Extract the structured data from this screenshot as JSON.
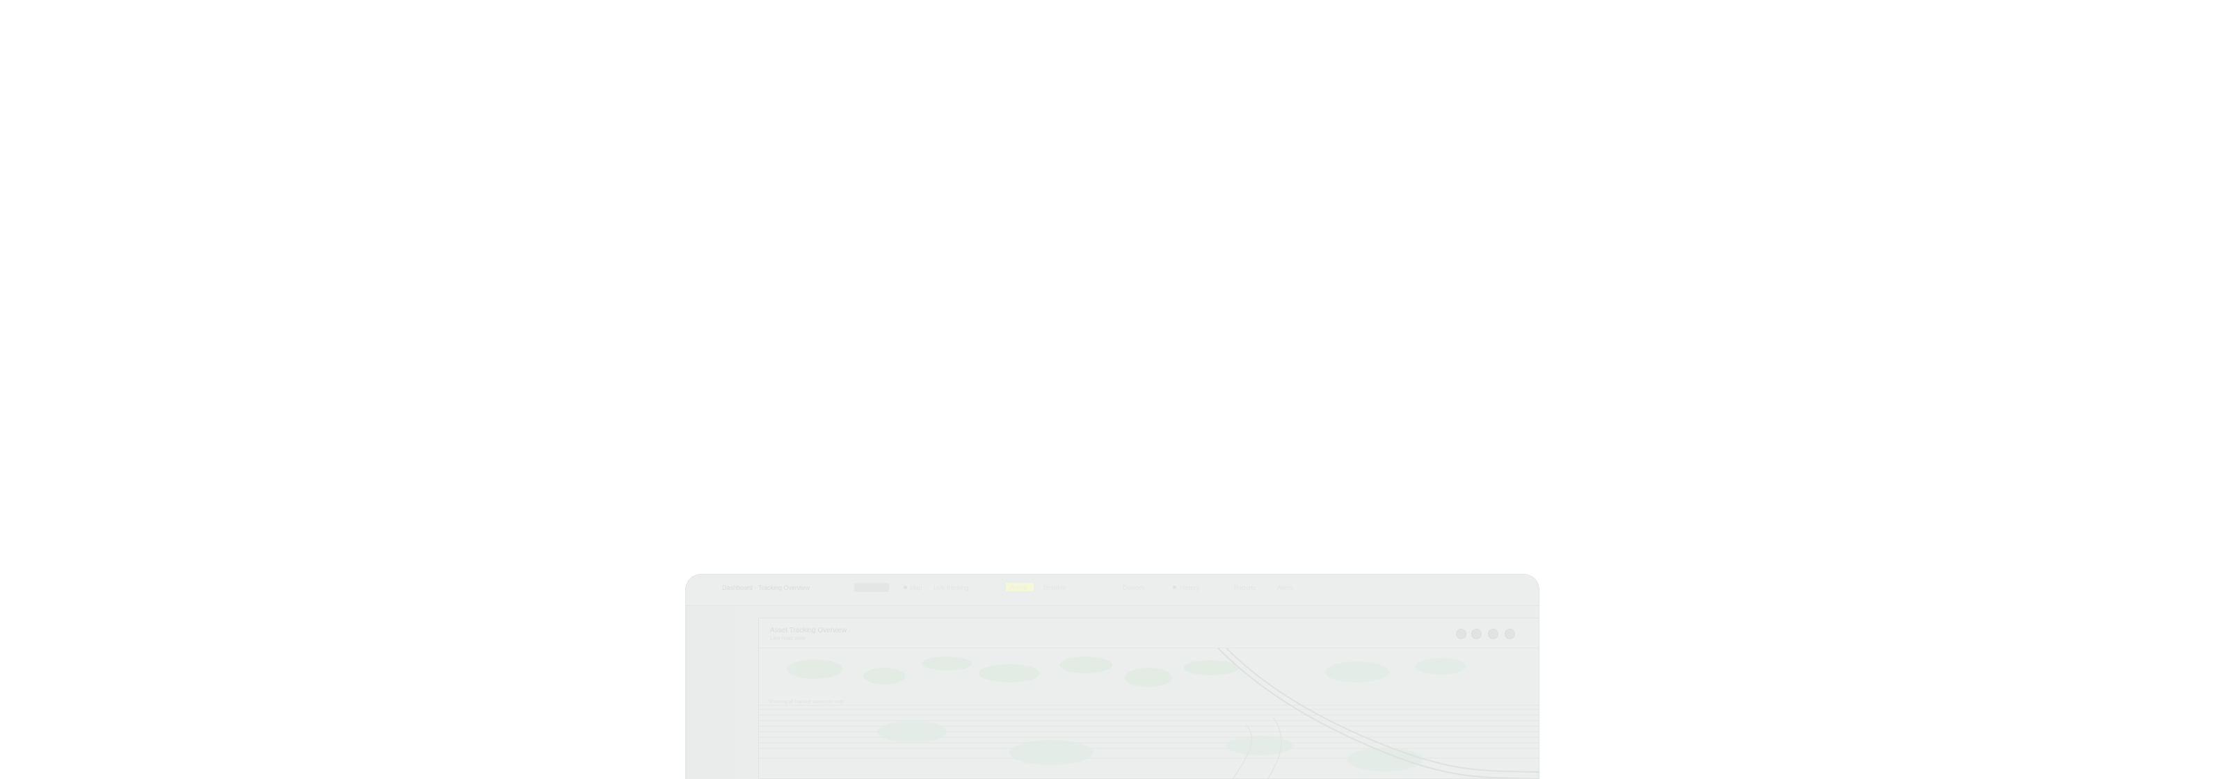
{
  "window": {
    "title": "Dashboard - Tracking Overview",
    "tabs": [
      "Filters",
      "Map",
      "Live tracking",
      "Active",
      "Timeline",
      "Devices",
      "History",
      "Reports",
      "Alerts"
    ],
    "active_tab": "Active"
  },
  "panel": {
    "title": "Asset Tracking Overview",
    "subtitle": "Live map view"
  },
  "status": {
    "text": "Showing all tracked assets on map"
  },
  "colors": {
    "accent_badge": "#f4f7d8",
    "map_route": "#e1e6e4",
    "map_vegetation": "#dde9e0"
  },
  "icons": {
    "header_actions": [
      "zoom-in-icon",
      "zoom-out-icon",
      "layers-icon",
      "fullscreen-icon"
    ]
  }
}
